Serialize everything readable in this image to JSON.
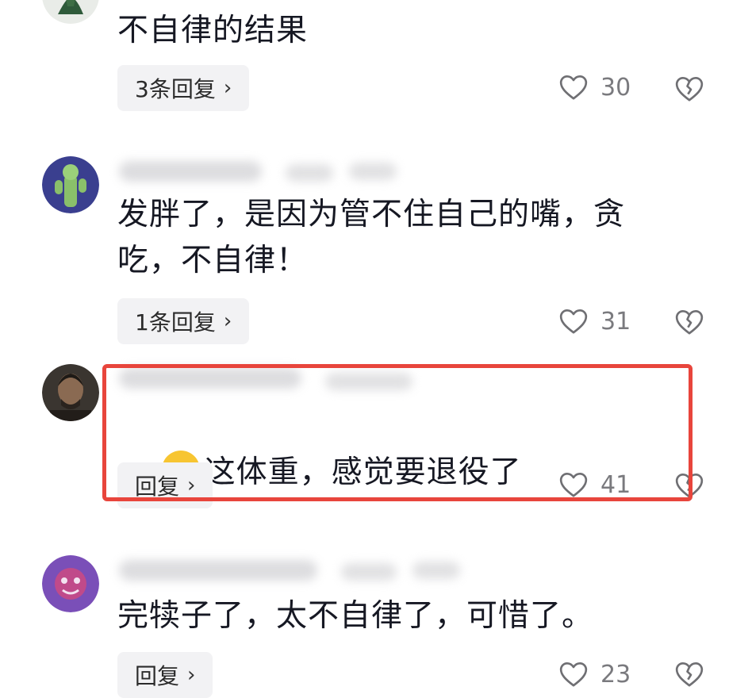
{
  "comments": [
    {
      "text": "不自律的结果",
      "reply_label": "3条回复",
      "likes": "30"
    },
    {
      "text": "发胖了，是因为管不住自己的嘴，贪\n吃，不自律！",
      "reply_label": "1条回复",
      "likes": "31"
    },
    {
      "text": "这体重，感觉要退役了",
      "emoji": "laughing-crying-emoji",
      "reply_label": "回复",
      "likes": "41"
    },
    {
      "text": "完犊子了，太不自律了，可惜了。",
      "reply_label": "回复",
      "likes": "23"
    }
  ],
  "icons": {
    "chevron": "chevron-right-icon",
    "like": "heart-outline-icon",
    "dislike": "broken-heart-outline-icon"
  },
  "colors": {
    "highlight_border": "#e8453c",
    "reply_bg": "#f2f2f4",
    "count_text": "#7a7a7e"
  }
}
